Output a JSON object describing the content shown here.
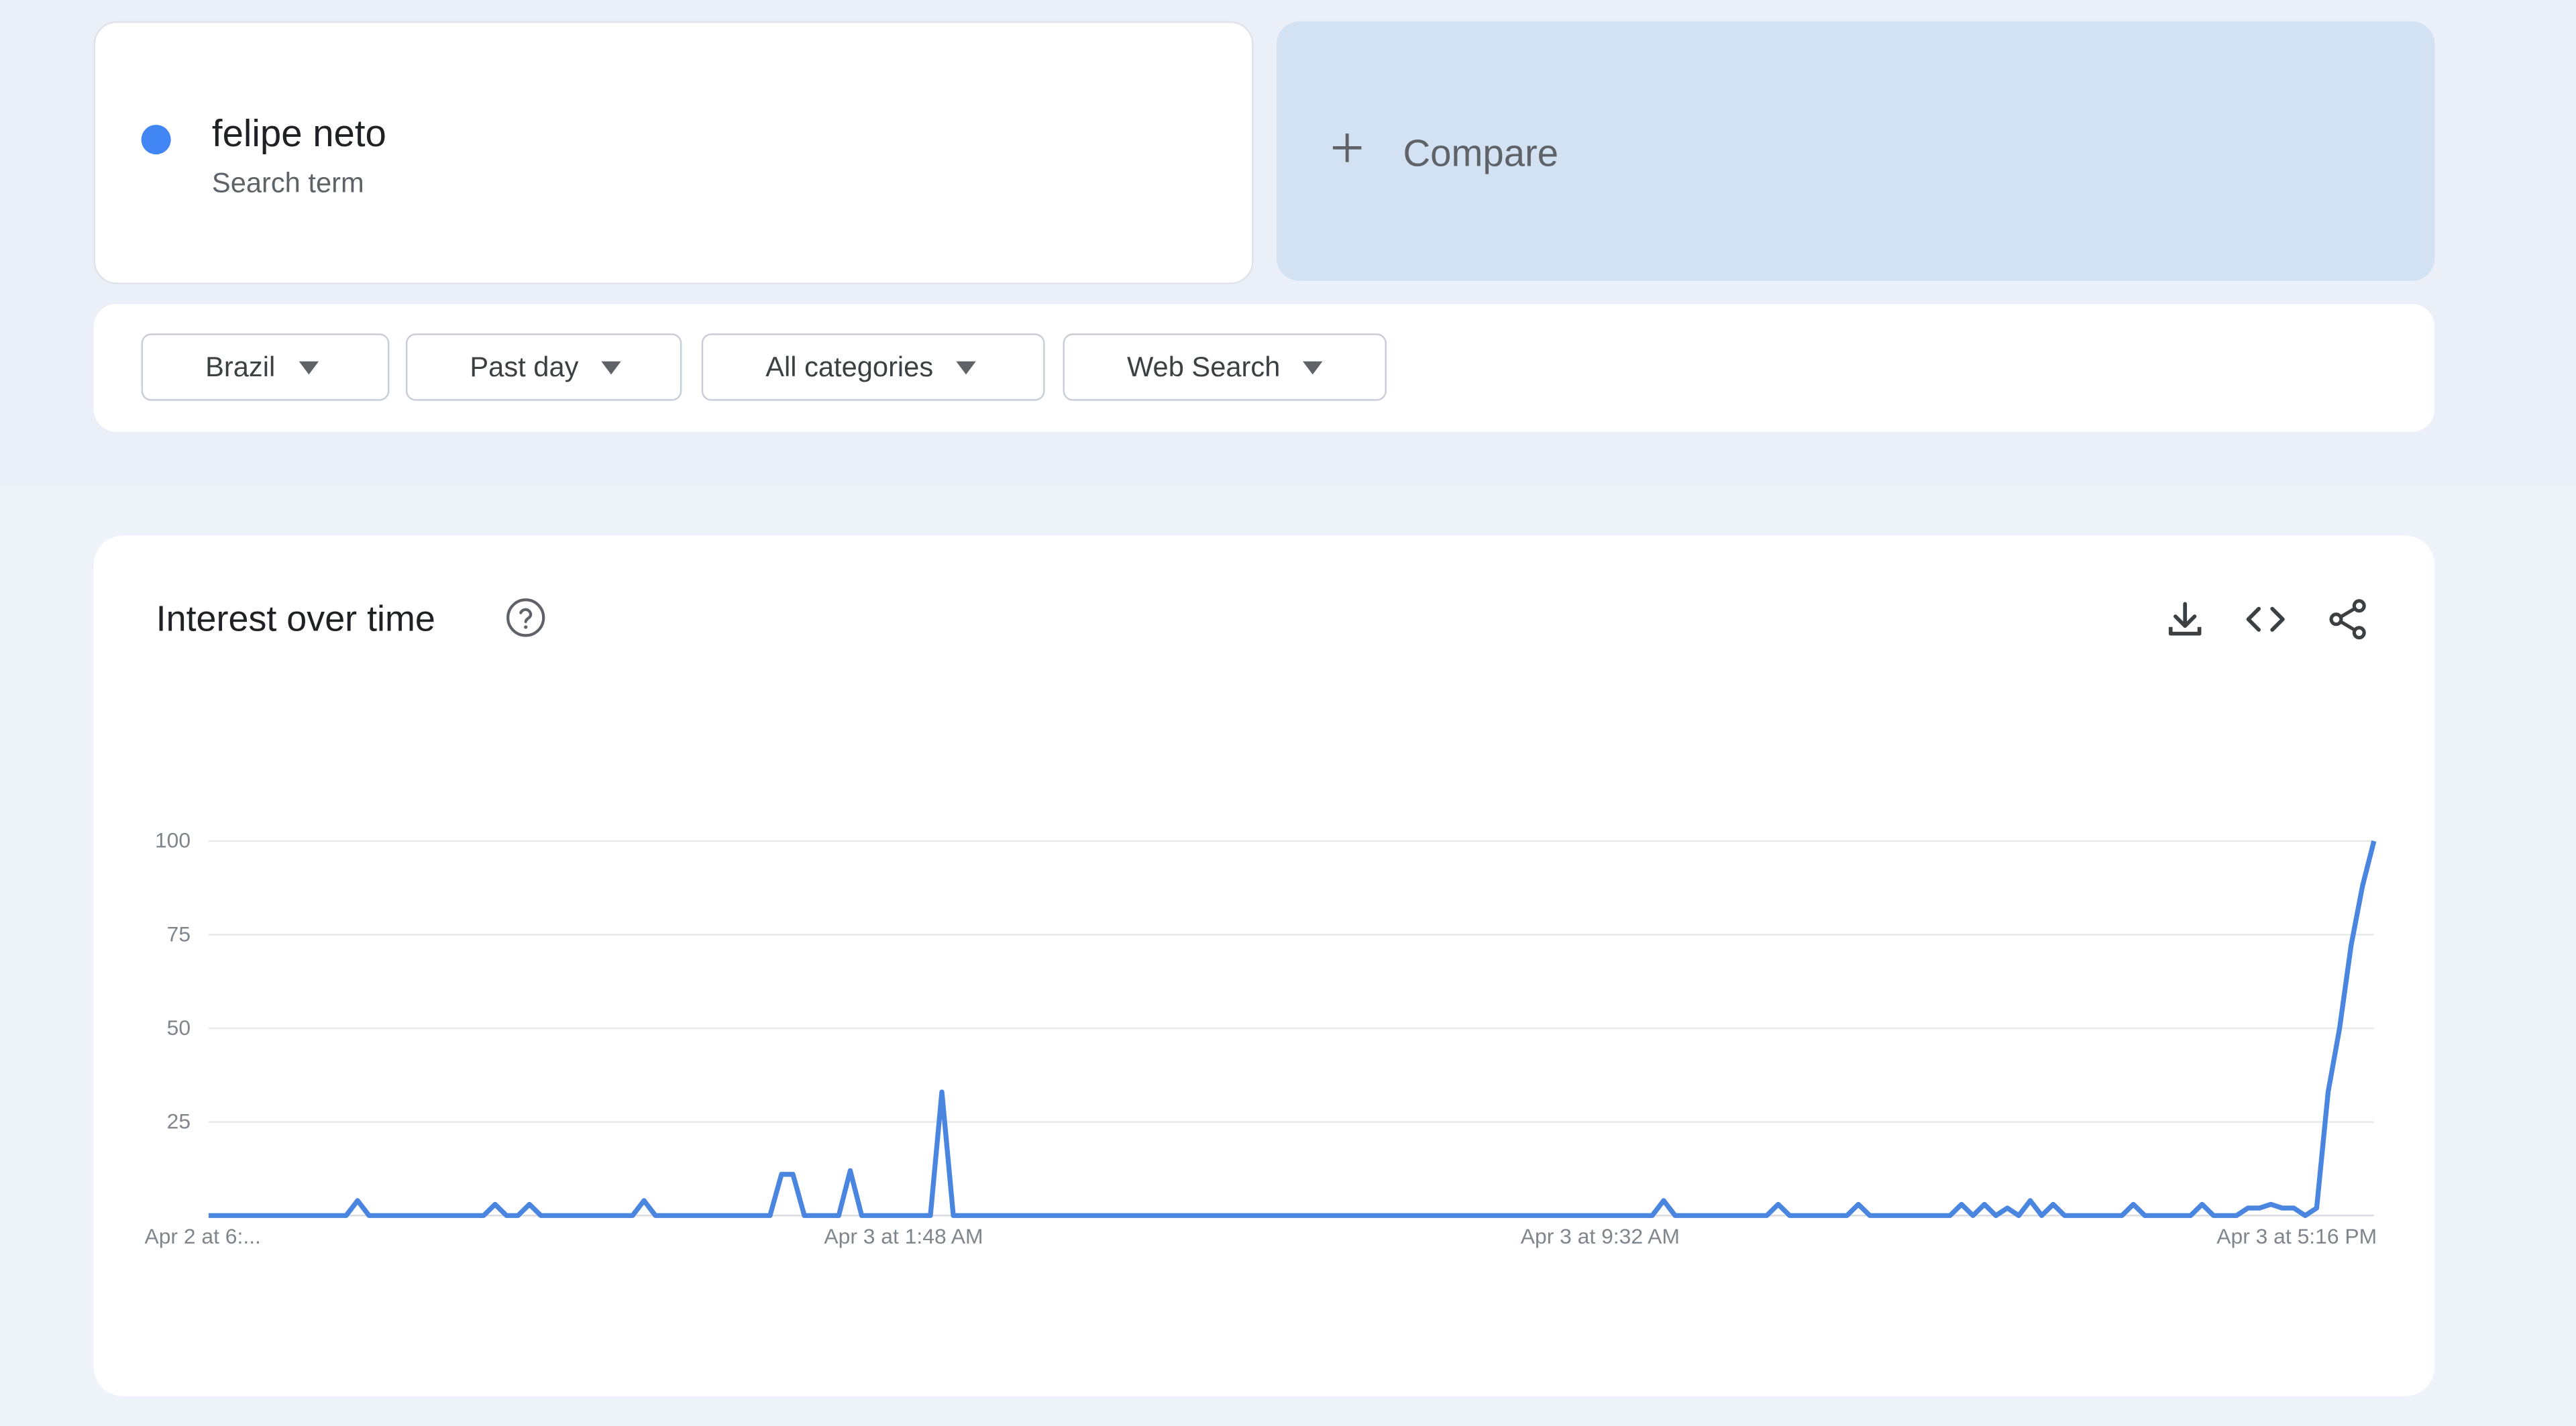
{
  "search_term": {
    "name": "felipe neto",
    "type": "Search term",
    "color": "#4285f4"
  },
  "compare": {
    "label": "Compare"
  },
  "filters": {
    "region": "Brazil",
    "time_range": "Past day",
    "category": "All categories",
    "property": "Web Search"
  },
  "chart_panel": {
    "title": "Interest over time",
    "icons": [
      "help-icon",
      "download-icon",
      "embed-icon",
      "share-icon"
    ]
  },
  "chart_data": {
    "type": "line",
    "title": "Interest over time",
    "xlabel": "",
    "ylabel": "",
    "ylim": [
      0,
      100
    ],
    "y_ticks": [
      25,
      50,
      75,
      100
    ],
    "x_tick_labels": [
      "Apr 2 at 6:...",
      "Apr 3 at 1:48 AM",
      "Apr 3 at 9:32 AM",
      "Apr 3 at 5:16 PM"
    ],
    "grid": true,
    "line_color": "#4a86e0",
    "series": [
      {
        "name": "felipe neto",
        "values": [
          0,
          0,
          0,
          0,
          0,
          0,
          0,
          0,
          0,
          0,
          0,
          0,
          0,
          4,
          0,
          0,
          0,
          0,
          0,
          0,
          0,
          0,
          0,
          0,
          0,
          3,
          0,
          0,
          3,
          0,
          0,
          0,
          0,
          0,
          0,
          0,
          0,
          0,
          4,
          0,
          0,
          0,
          0,
          0,
          0,
          0,
          0,
          0,
          0,
          0,
          11,
          11,
          0,
          0,
          0,
          0,
          12,
          0,
          0,
          0,
          0,
          0,
          0,
          0,
          33,
          0,
          0,
          0,
          0,
          0,
          0,
          0,
          0,
          0,
          0,
          0,
          0,
          0,
          0,
          0,
          0,
          0,
          0,
          0,
          0,
          0,
          0,
          0,
          0,
          0,
          0,
          0,
          0,
          0,
          0,
          0,
          0,
          0,
          0,
          0,
          0,
          0,
          0,
          0,
          0,
          0,
          0,
          0,
          0,
          0,
          0,
          0,
          0,
          0,
          0,
          0,
          0,
          0,
          0,
          0,
          0,
          0,
          0,
          0,
          0,
          0,
          0,
          4,
          0,
          0,
          0,
          0,
          0,
          0,
          0,
          0,
          0,
          3,
          0,
          0,
          0,
          0,
          0,
          0,
          3,
          0,
          0,
          0,
          0,
          0,
          0,
          0,
          0,
          3,
          0,
          3,
          0,
          2,
          0,
          4,
          0,
          3,
          0,
          0,
          0,
          0,
          0,
          0,
          3,
          0,
          0,
          0,
          0,
          0,
          3,
          0,
          0,
          0,
          2,
          2,
          3,
          2,
          2,
          0,
          2,
          33,
          50,
          72,
          88,
          100
        ]
      }
    ]
  }
}
